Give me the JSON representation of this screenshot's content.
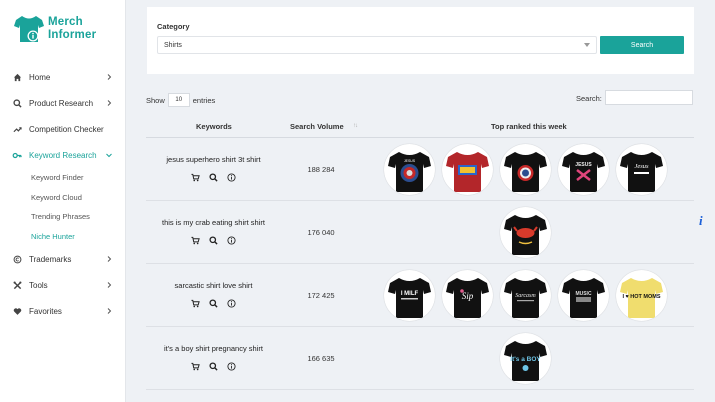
{
  "brand": {
    "line1": "Merch",
    "line2": "Informer",
    "accent": "#1aa39a"
  },
  "nav": [
    {
      "label": "Home",
      "icon": "home-icon",
      "chevron": "right"
    },
    {
      "label": "Product Research",
      "icon": "search-icon",
      "chevron": "right"
    },
    {
      "label": "Competition Checker",
      "icon": "trend-icon",
      "chevron": ""
    },
    {
      "label": "Keyword Research",
      "icon": "key-icon",
      "chevron": "down",
      "active": true
    }
  ],
  "subnav": [
    "Keyword Finder",
    "Keyword Cloud",
    "Trending Phrases",
    "Niche Hunter"
  ],
  "nav_bottom": [
    {
      "label": "Trademarks",
      "icon": "copyright-icon"
    },
    {
      "label": "Tools",
      "icon": "tools-icon"
    },
    {
      "label": "Favorites",
      "icon": "heart-icon"
    }
  ],
  "filter": {
    "label": "Category",
    "value": "Shirts",
    "button": "Search"
  },
  "table_controls": {
    "show": "Show",
    "entries_value": "10",
    "entries": "entries",
    "search_label": "Search:"
  },
  "table": {
    "headers": {
      "keywords": "Keywords",
      "volume": "Search Volume",
      "top": "Top ranked this week"
    },
    "rows": [
      {
        "keyword": "jesus superhero shirt 3t shirt",
        "volume": "188 284",
        "thumbs": 5
      },
      {
        "keyword": "this is my crab eating shirt shirt",
        "volume": "176 040",
        "thumbs": 1
      },
      {
        "keyword": "sarcastic shirt love shirt",
        "volume": "172 425",
        "thumbs": 5
      },
      {
        "keyword": "it's a boy shirt pregnancy shirt",
        "volume": "166 635",
        "thumbs": 1
      }
    ]
  },
  "thumb_texts": {
    "r0": [
      "JESUS",
      "",
      "",
      "JESUS",
      "Jesus"
    ],
    "r2": [
      "I MILF",
      "Sip",
      "Sarcasm",
      "MUSIC",
      "I ♥ HOT MOMS"
    ],
    "r3": [
      "It's a BOY"
    ]
  }
}
